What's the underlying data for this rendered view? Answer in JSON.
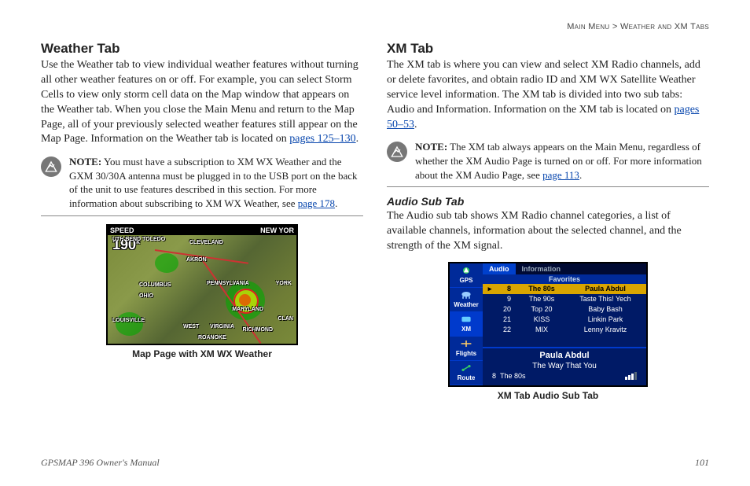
{
  "breadcrumb": {
    "left": "Main Menu",
    "sep": ">",
    "right": "Weather and XM Tabs"
  },
  "left": {
    "heading": "Weather Tab",
    "para1a": "Use the Weather tab to view individual weather features without turning all other weather features on or off. For example, you can select Storm Cells to view only storm cell data on the Map window that appears on the Weather tab. When you close the Main Menu and return to the Map Page, all of your previously selected weather features still appear on the Map Page. Information on the Weather tab is located on ",
    "para1_link": "pages 125–130",
    "para1b": ".",
    "note_label": "NOTE:",
    "note_a": " You must have a subscription to XM WX Weather and the GXM 30/30A antenna must be plugged in to the USB port on the back of the unit to use features described in this section. For more information about subscribing to XM WX Weather, see ",
    "note_link": "page 178",
    "note_b": ".",
    "caption": "Map Page with XM WX Weather",
    "map": {
      "top_left": "SPEED",
      "top_right": "NEW YOR",
      "speed": "190",
      "labels": {
        "toledo": "UTH BEND TOLEDO",
        "cleveland": "CLEVELAND",
        "akron": "AKRON",
        "columbus": "COLUMBUS",
        "ohio": "OHIO",
        "penn": "PENNSYLVANIA",
        "york": "YORK",
        "louisville": "LOUISVILLE",
        "west": "WEST",
        "virginia": "VIRGINIA",
        "maryland": "MARYLAND",
        "richmond": "RICHMOND",
        "roanoke": "ROANOKE",
        "clan": "CLAN"
      }
    }
  },
  "right": {
    "heading": "XM Tab",
    "para1a": "The XM tab is where you can view and select XM Radio channels, add or delete favorites, and obtain radio ID and XM WX Satellite Weather service level information. The XM tab is divided into two sub tabs: Audio and Information. Information on the XM tab is located on ",
    "para1_link": "pages 50–53",
    "para1b": ".",
    "note_label": "NOTE:",
    "note_a": " The XM tab always appears on the Main Menu, regardless of whether the XM Audio Page is turned on or off. For more information about the XM Audio Page, see ",
    "note_link": "page 113",
    "note_b": ".",
    "sub_heading": "Audio Sub Tab",
    "para2": "The Audio sub tab shows XM Radio channel categories, a list of available channels, information about the selected channel, and the strength of the XM signal.",
    "caption": "XM Tab Audio Sub Tab",
    "xm": {
      "side": [
        "GPS",
        "Weather",
        "XM",
        "Flights",
        "Route"
      ],
      "tabs": {
        "audio": "Audio",
        "info": "Information"
      },
      "subhead": "Favorites",
      "rows": [
        {
          "ch": "8",
          "name": "The 80s",
          "artist": "Paula Abdul",
          "sel": true
        },
        {
          "ch": "9",
          "name": "The 90s",
          "artist": "Taste This! Yech",
          "sel": false
        },
        {
          "ch": "20",
          "name": "Top 20",
          "artist": "Baby Bash",
          "sel": false
        },
        {
          "ch": "21",
          "name": "KISS",
          "artist": "Linkin Park",
          "sel": false
        },
        {
          "ch": "22",
          "name": "MIX",
          "artist": "Lenny Kravitz",
          "sel": false
        }
      ],
      "now": {
        "artist": "Paula Abdul",
        "song": "The Way That You",
        "ch": "8",
        "chname": "The 80s"
      }
    }
  },
  "footer": {
    "left": "GPSMAP 396 Owner's Manual",
    "right": "101"
  }
}
